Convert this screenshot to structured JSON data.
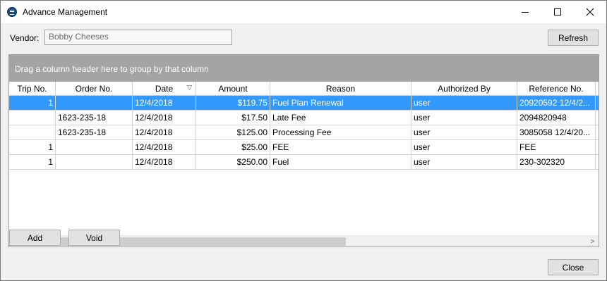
{
  "window": {
    "title": "Advance Management",
    "icon": "app-logo-icon",
    "minimize_glyph": "",
    "close_glyph": "✕"
  },
  "vendor": {
    "label": "Vendor:",
    "value": "Bobby Cheeses"
  },
  "toolbar": {
    "refresh_label": "Refresh",
    "add_label": "Add",
    "void_label": "Void",
    "close_label": "Close"
  },
  "grid": {
    "group_panel_text": "Drag a column header here to group by that column",
    "columns": [
      "Trip No.",
      "Order No.",
      "Date",
      "Amount",
      "Reason",
      "Authorized By",
      "Reference No.",
      "M"
    ],
    "sort_icon": "▽",
    "rows": [
      {
        "trip": "1",
        "order": "",
        "date": "12/4/2018",
        "amount": "$119.75",
        "reason": "Fuel Plan Renewal",
        "authorized_by": "user",
        "reference": "20920592 12/4/2..."
      },
      {
        "trip": "",
        "order": "1623-235-18",
        "date": "12/4/2018",
        "amount": "$17.50",
        "reason": "Late Fee",
        "authorized_by": "user",
        "reference": "2094820948"
      },
      {
        "trip": "",
        "order": "1623-235-18",
        "date": "12/4/2018",
        "amount": "$125.00",
        "reason": "Processing Fee",
        "authorized_by": "user",
        "reference": "3085058 12/4/20..."
      },
      {
        "trip": "1",
        "order": "",
        "date": "12/4/2018",
        "amount": "$25.00",
        "reason": "FEE",
        "authorized_by": "user",
        "reference": "FEE"
      },
      {
        "trip": "1",
        "order": "",
        "date": "12/4/2018",
        "amount": "$250.00",
        "reason": "Fuel",
        "authorized_by": "user",
        "reference": "230-302320"
      }
    ],
    "scroll_left": "<",
    "scroll_right": ">"
  },
  "colors": {
    "selection": "#3399ff",
    "group_panel": "#a4a4a4"
  }
}
